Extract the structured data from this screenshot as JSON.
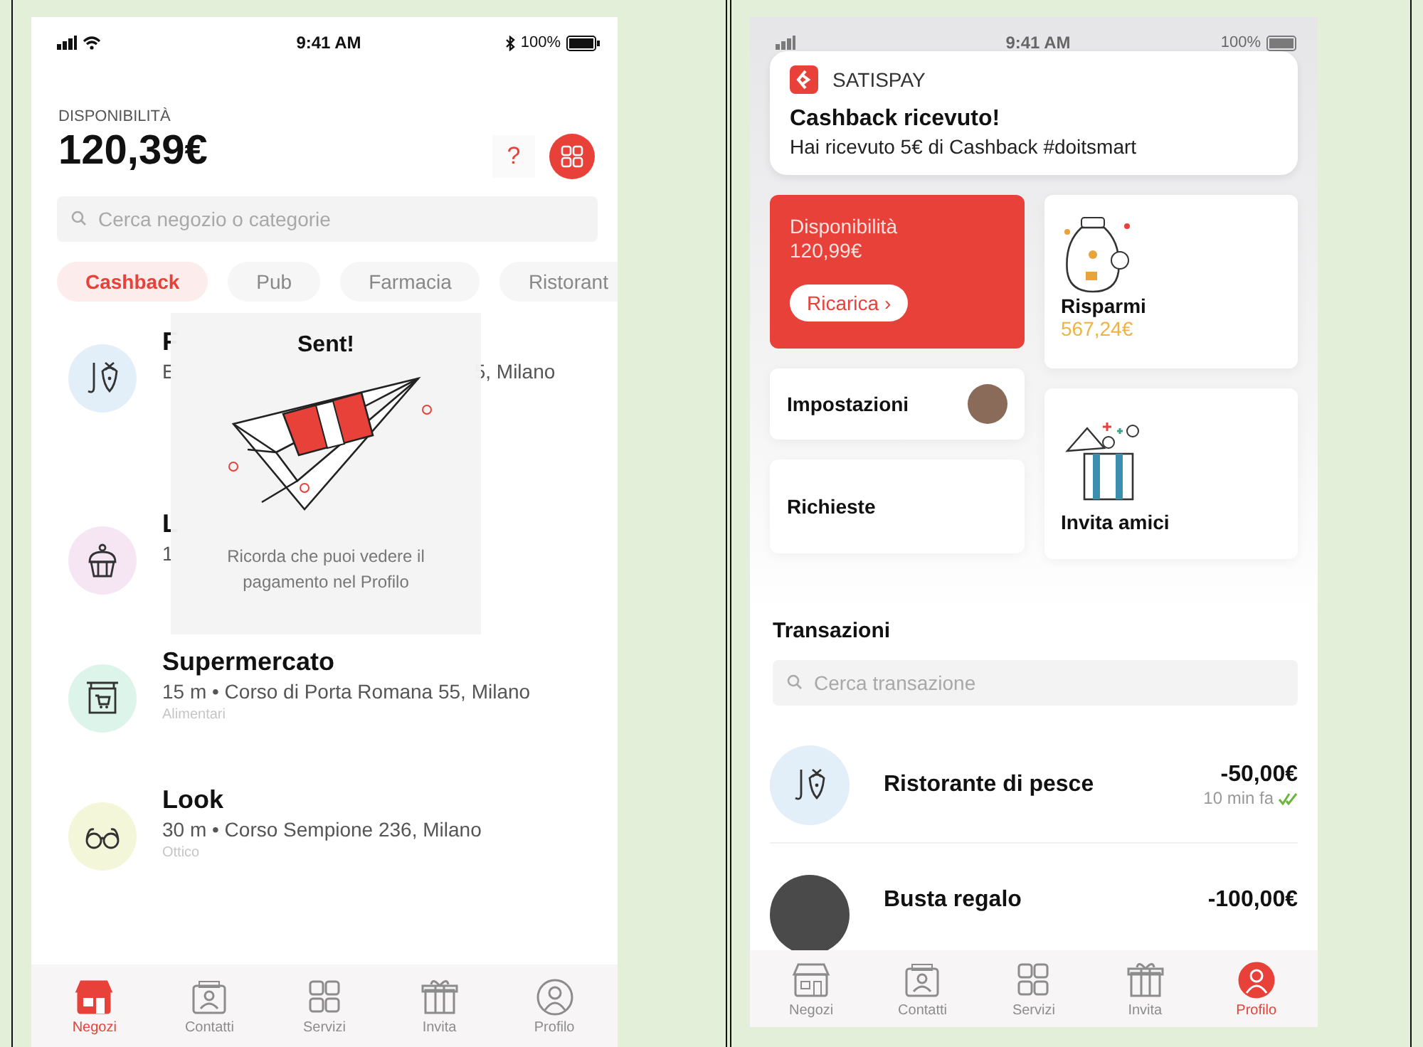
{
  "left_screen": {
    "status_bar": {
      "time": "9:41 AM",
      "battery": "100%"
    },
    "balance_label": "DISPONIBILITÀ",
    "balance": "120,39€",
    "help_button": "?",
    "search": {
      "placeholder": "Cerca negozio o categorie"
    },
    "chips": [
      {
        "label": "Cashback",
        "selected": true
      },
      {
        "label": "Pub",
        "selected": false
      },
      {
        "label": "Farmacia",
        "selected": false
      },
      {
        "label": "Ristorant",
        "selected": false
      }
    ],
    "shops": [
      {
        "kind": "fish",
        "name": "F",
        "address": "E",
        "address_end": "5, Milano"
      },
      {
        "kind": "cupcake",
        "name": "L",
        "address": "1"
      },
      {
        "kind": "cart",
        "name": "Supermercato",
        "address": "15 m • Corso di Porta Romana 55, Milano",
        "category": "Alimentari"
      },
      {
        "kind": "glasses",
        "name": "Look",
        "address": "30 m • Corso Sempione 236, Milano",
        "category": "Ottico"
      }
    ],
    "overlay": {
      "title": "Sent!",
      "message": "Ricorda che puoi vedere il pagamento nel Profilo"
    },
    "tab_bar": [
      {
        "kind": "shop",
        "label": "Negozi",
        "selected": true
      },
      {
        "kind": "contacts",
        "label": "Contatti",
        "selected": false
      },
      {
        "kind": "services",
        "label": "Servizi",
        "selected": false
      },
      {
        "kind": "gift",
        "label": "Invita",
        "selected": false
      },
      {
        "kind": "profile",
        "label": "Profilo",
        "selected": false
      }
    ]
  },
  "right_screen": {
    "status_bar": {
      "time": "9:41 AM",
      "battery": "100%"
    },
    "notification": {
      "app": "SATISPAY",
      "title": "Cashback ricevuto!",
      "body": "Hai ricevuto 5€ di Cashback #doitsmart"
    },
    "balance_card": {
      "label": "Disponibilità",
      "amount": "120,99€",
      "button": "Ricarica ›"
    },
    "savings_card": {
      "label": "Risparmi",
      "amount": "567,24€"
    },
    "settings_tile": {
      "label": "Impostazioni"
    },
    "requests_tile": {
      "label": "Richieste"
    },
    "invite_card": {
      "label": "Invita amici"
    },
    "transactions": {
      "title": "Transazioni",
      "search": {
        "placeholder": "Cerca transazione"
      },
      "rows": [
        {
          "kind": "fish",
          "name": "Ristorante di pesce",
          "amount": "-50,00€",
          "time": "10 min fa",
          "confirmed": true
        },
        {
          "kind": "person",
          "name": "Busta regalo",
          "amount": "-100,00€"
        }
      ]
    },
    "tab_bar": [
      {
        "kind": "shop",
        "label": "Negozi",
        "selected": false
      },
      {
        "kind": "contacts",
        "label": "Contatti",
        "selected": false
      },
      {
        "kind": "services",
        "label": "Servizi",
        "selected": false
      },
      {
        "kind": "gift",
        "label": "Invita",
        "selected": false
      },
      {
        "kind": "profile",
        "label": "Profilo",
        "selected": true
      }
    ]
  }
}
